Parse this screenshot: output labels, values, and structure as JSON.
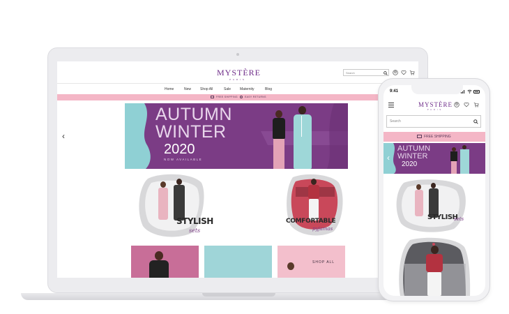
{
  "brand": {
    "logo": "MYSTÈRE",
    "tagline": "PARIS"
  },
  "laptop": {
    "search_placeholder": "Search",
    "nav": [
      "Home",
      "New",
      "Shop All",
      "Sale",
      "Maternity",
      "Blog"
    ],
    "shipping": [
      "FREE SHIPPING",
      "EASY RETURNS"
    ],
    "banner": {
      "line1": "AUTUMN",
      "line2": "WINTER",
      "year": "2020",
      "sub": "NOW AVAILABLE"
    },
    "promo1": {
      "title": "STYLISH",
      "script": "sets"
    },
    "promo2": {
      "title": "COMFORTABLE",
      "script": "pyjamas"
    },
    "card3_label": "SHOP ALL",
    "arrow_left": "‹"
  },
  "phone": {
    "time": "9:41",
    "search_placeholder": "Search",
    "shipping": "FREE SHIPPING",
    "banner": {
      "line1": "AUTUMN",
      "line2": "WINTER",
      "year": "2020"
    },
    "promo1": {
      "title": "STYLISH",
      "script": "sets"
    },
    "arrow_left": "‹"
  },
  "colors": {
    "brand_purple": "#6f2d8a",
    "banner_purple": "#7b3c85",
    "teal": "#8fd0d4",
    "pink": "#f4b6c6",
    "card_mauve": "#c86e98",
    "card_teal": "#9fd5d8",
    "card_pink": "#f3bfcc"
  }
}
